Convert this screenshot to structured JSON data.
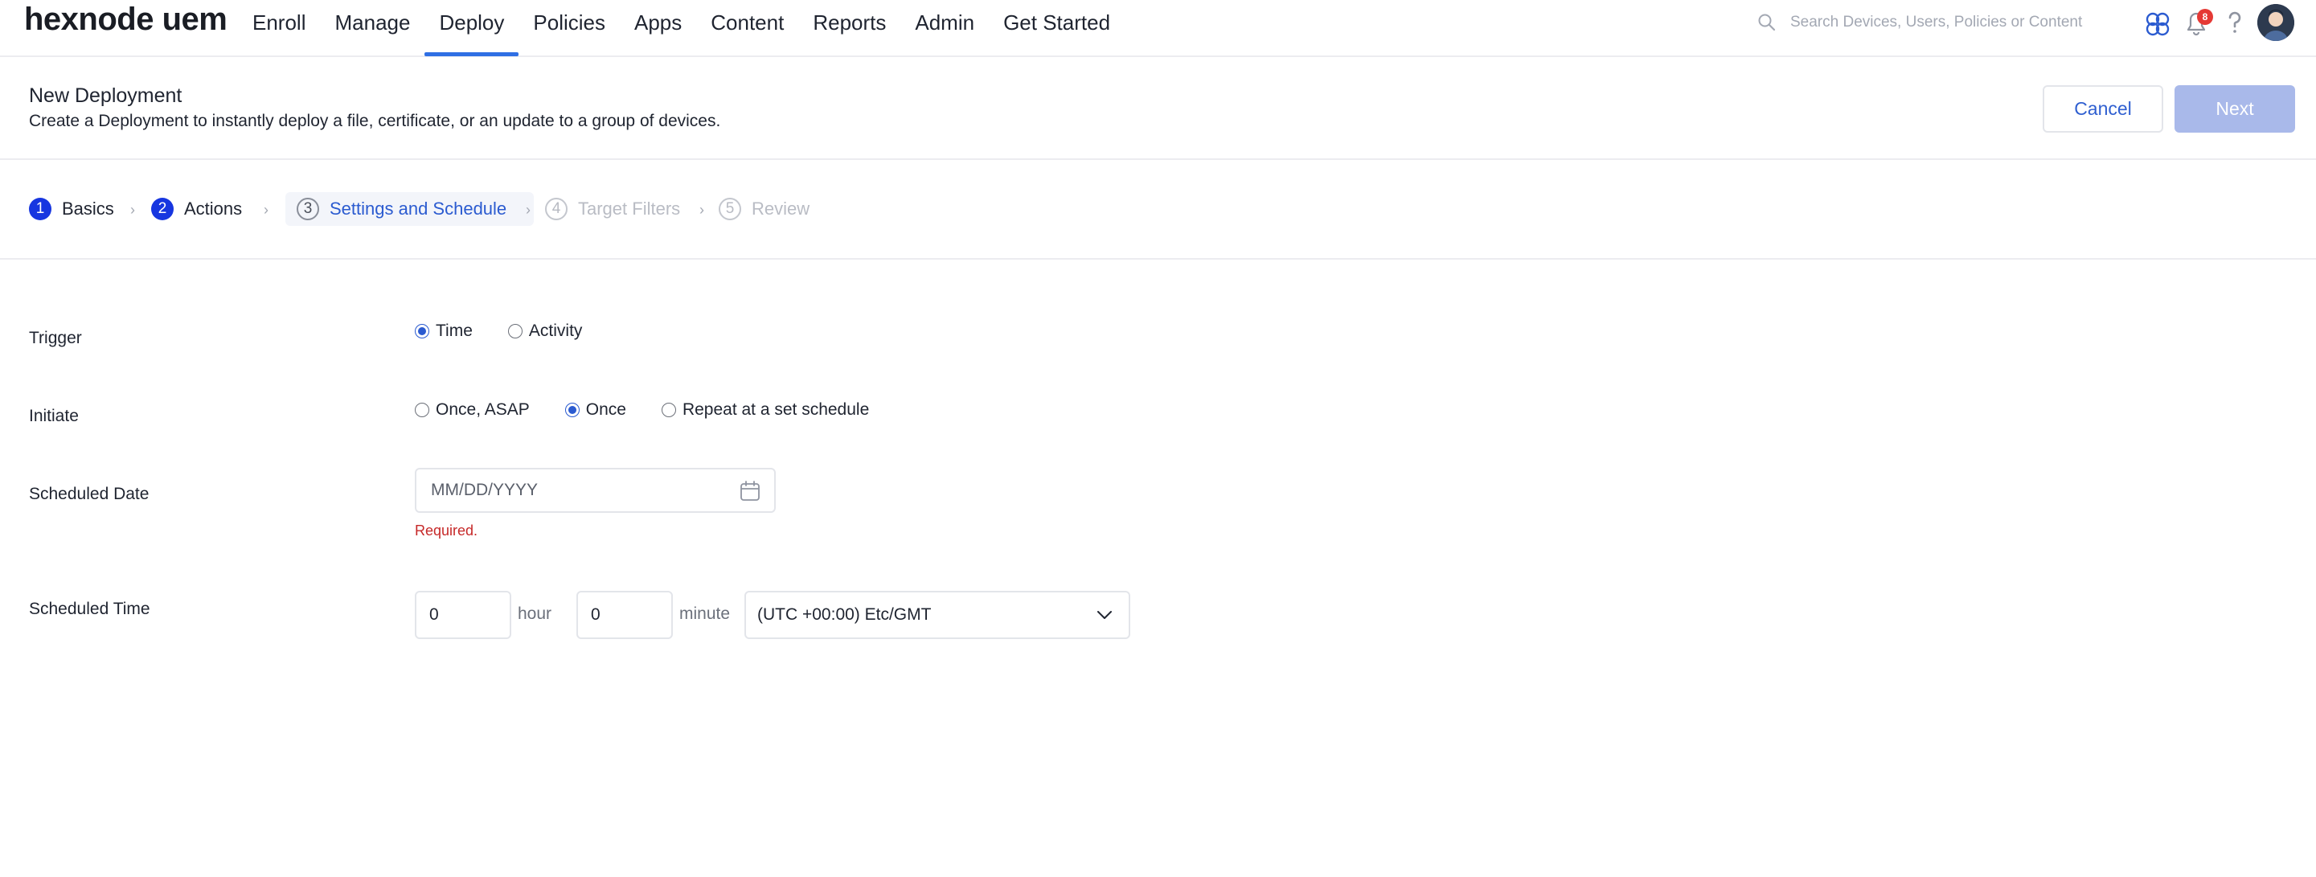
{
  "app": {
    "logo": "hexnode uem"
  },
  "nav": {
    "items": [
      {
        "label": "Enroll",
        "active": false
      },
      {
        "label": "Manage",
        "active": false
      },
      {
        "label": "Deploy",
        "active": true
      },
      {
        "label": "Policies",
        "active": false
      },
      {
        "label": "Apps",
        "active": false
      },
      {
        "label": "Content",
        "active": false
      },
      {
        "label": "Reports",
        "active": false
      },
      {
        "label": "Admin",
        "active": false
      },
      {
        "label": "Get Started",
        "active": false
      }
    ]
  },
  "search": {
    "placeholder": "Search Devices, Users, Policies or Content",
    "value": ""
  },
  "top_icons": {
    "items": [
      "integration-icon",
      "bell-icon",
      "help-icon",
      "avatar"
    ],
    "notification_count": "8"
  },
  "header": {
    "title": "New Deployment",
    "subtitle": "Create a Deployment to instantly deploy a file, certificate, or an update to a group of devices.",
    "cancel_label": "Cancel",
    "next_label": "Next"
  },
  "stepper": {
    "steps": [
      {
        "num": "1",
        "label": "Basics",
        "state": "done"
      },
      {
        "num": "2",
        "label": "Actions",
        "state": "done"
      },
      {
        "num": "3",
        "label": "Settings and Schedule",
        "state": "current"
      },
      {
        "num": "4",
        "label": "Target Filters",
        "state": "future"
      },
      {
        "num": "5",
        "label": "Review",
        "state": "future"
      }
    ]
  },
  "form": {
    "trigger": {
      "label": "Trigger",
      "options": [
        {
          "label": "Time",
          "checked": true
        },
        {
          "label": "Activity",
          "checked": false
        }
      ]
    },
    "initiate": {
      "label": "Initiate",
      "options": [
        {
          "label": "Once, ASAP",
          "checked": false
        },
        {
          "label": "Once",
          "checked": true
        },
        {
          "label": "Repeat at a set schedule",
          "checked": false
        }
      ]
    },
    "scheduled_date": {
      "label": "Scheduled Date",
      "placeholder": "MM/DD/YYYY",
      "value": "",
      "error": "Required."
    },
    "scheduled_time": {
      "label": "Scheduled Time",
      "hour_value": "0",
      "hour_unit": "hour",
      "minute_value": "0",
      "minute_unit": "minute",
      "timezone": "(UTC +00:00) Etc/GMT"
    }
  },
  "colors": {
    "accent": "#2b5bd0",
    "active_tab_underline": "#2f6fe4",
    "step_done": "#1736e0",
    "next_disabled": "#a9b9ea",
    "error": "#c62828",
    "badge": "#e53935"
  }
}
